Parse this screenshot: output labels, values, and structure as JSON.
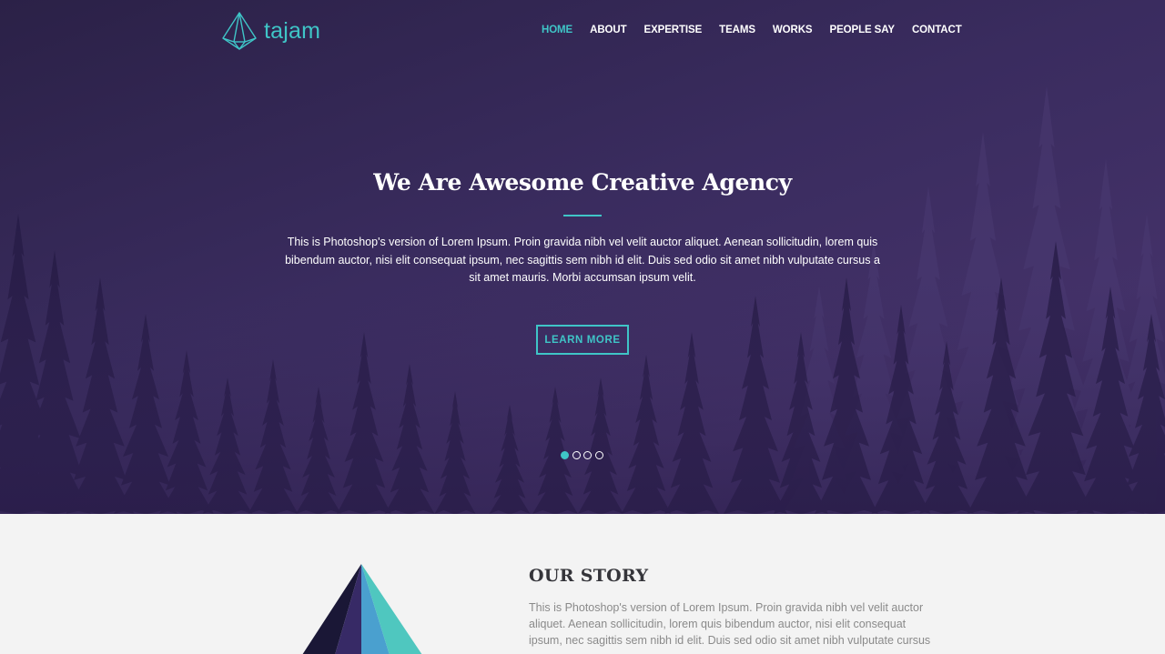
{
  "brand": {
    "name": "tajam",
    "logo_icon": "pyramid-icon",
    "accent": "#3fc5c7"
  },
  "nav": {
    "items": [
      {
        "label": "HOME",
        "active": true
      },
      {
        "label": "ABOUT",
        "active": false
      },
      {
        "label": "EXPERTISE",
        "active": false
      },
      {
        "label": "TEAMS",
        "active": false
      },
      {
        "label": "WORKS",
        "active": false
      },
      {
        "label": "PEOPLE SAY",
        "active": false
      },
      {
        "label": "CONTACT",
        "active": false
      }
    ]
  },
  "hero": {
    "title": "We Are Awesome Creative Agency",
    "description": "This is Photoshop's version of Lorem Ipsum. Proin gravida nibh vel velit auctor aliquet. Aenean sollicitudin, lorem quis bibendum auctor, nisi elit consequat ipsum, nec sagittis sem nibh id elit. Duis sed odio sit amet nibh vulputate cursus a sit amet mauris. Morbi accumsan ipsum velit.",
    "button_label": "LEARN MORE",
    "slides_total": 4,
    "slide_active": 1,
    "background_colors": [
      "#2b2147",
      "#433168"
    ]
  },
  "story": {
    "title": "OUR STORY",
    "text": "This is Photoshop's version of Lorem Ipsum. Proin gravida nibh vel velit auctor aliquet. Aenean sollicitudin, lorem quis bibendum auctor, nisi elit consequat ipsum, nec sagittis sem nibh id elit. Duis sed odio sit amet nibh vulputate cursus",
    "illustration_icon": "pyramid-illustration",
    "pyramid_colors": [
      "#1a1736",
      "#372a66",
      "#4aa0cf",
      "#4fc7bf"
    ]
  }
}
